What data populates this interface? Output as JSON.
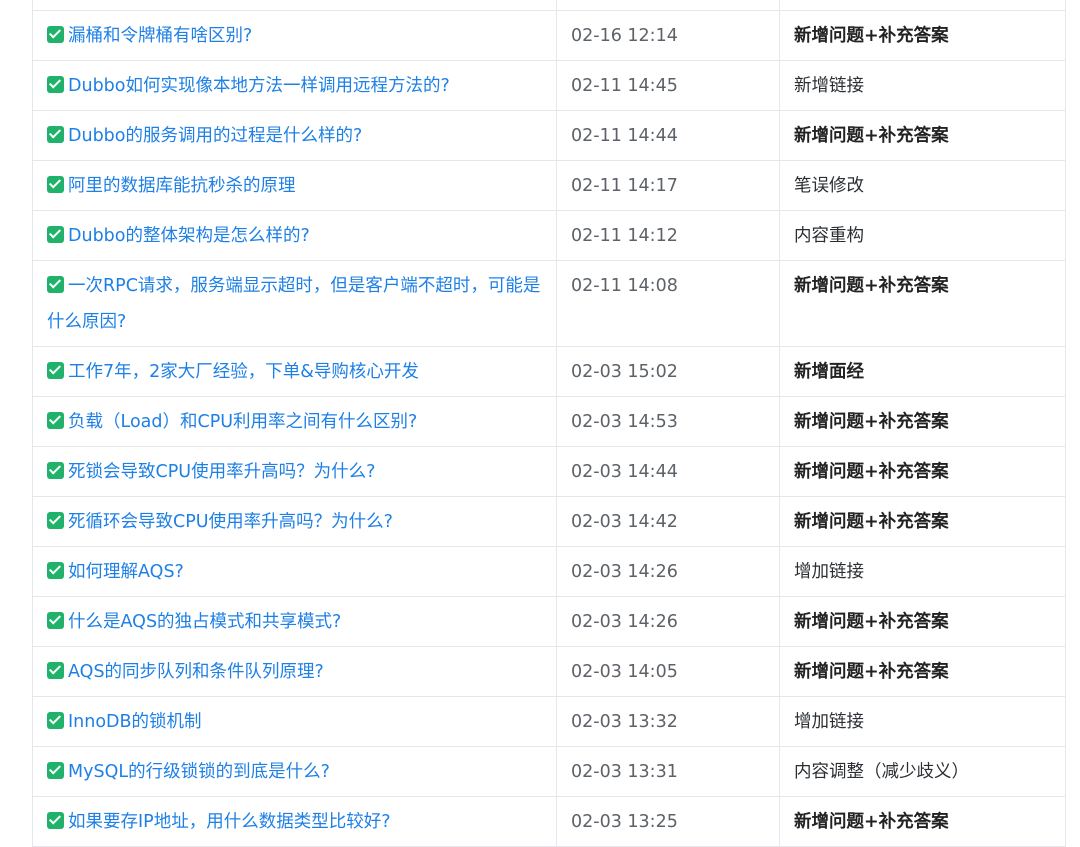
{
  "rows": [
    {
      "title": "漏桶和令牌桶有啥区别?",
      "time": "02-16 12:14",
      "desc": "新增问题+补充答案",
      "bold": true
    },
    {
      "title": "Dubbo如何实现像本地方法一样调用远程方法的?",
      "time": "02-11 14:45",
      "desc": "新增链接",
      "bold": false
    },
    {
      "title": "Dubbo的服务调用的过程是什么样的?",
      "time": "02-11 14:44",
      "desc": "新增问题+补充答案",
      "bold": true
    },
    {
      "title": "阿里的数据库能抗秒杀的原理",
      "time": "02-11 14:17",
      "desc": "笔误修改",
      "bold": false
    },
    {
      "title": "Dubbo的整体架构是怎么样的?",
      "time": "02-11 14:12",
      "desc": "内容重构",
      "bold": false
    },
    {
      "title": "一次RPC请求，服务端显示超时，但是客户端不超时，可能是什么原因?",
      "time": "02-11 14:08",
      "desc": "新增问题+补充答案",
      "bold": true
    },
    {
      "title": "工作7年，2家大厂经验，下单&导购核心开发",
      "time": "02-03 15:02",
      "desc": "新增面经",
      "bold": true
    },
    {
      "title": "负载（Load）和CPU利用率之间有什么区别?",
      "time": "02-03 14:53",
      "desc": "新增问题+补充答案",
      "bold": true
    },
    {
      "title": "死锁会导致CPU使用率升高吗？为什么?",
      "time": "02-03 14:44",
      "desc": "新增问题+补充答案",
      "bold": true
    },
    {
      "title": "死循环会导致CPU使用率升高吗？为什么?",
      "time": "02-03 14:42",
      "desc": "新增问题+补充答案",
      "bold": true
    },
    {
      "title": "如何理解AQS?",
      "time": "02-03 14:26",
      "desc": "增加链接",
      "bold": false
    },
    {
      "title": "什么是AQS的独占模式和共享模式?",
      "time": "02-03 14:26",
      "desc": "新增问题+补充答案",
      "bold": true
    },
    {
      "title": "AQS的同步队列和条件队列原理?",
      "time": "02-03 14:05",
      "desc": "新增问题+补充答案",
      "bold": true
    },
    {
      "title": "InnoDB的锁机制",
      "time": "02-03 13:32",
      "desc": "增加链接",
      "bold": false
    },
    {
      "title": "MySQL的行级锁锁的到底是什么?",
      "time": "02-03 13:31",
      "desc": "内容调整（减少歧义）",
      "bold": false
    },
    {
      "title": "如果要存IP地址，用什么数据类型比较好?",
      "time": "02-03 13:25",
      "desc": "新增问题+补充答案",
      "bold": true
    }
  ]
}
